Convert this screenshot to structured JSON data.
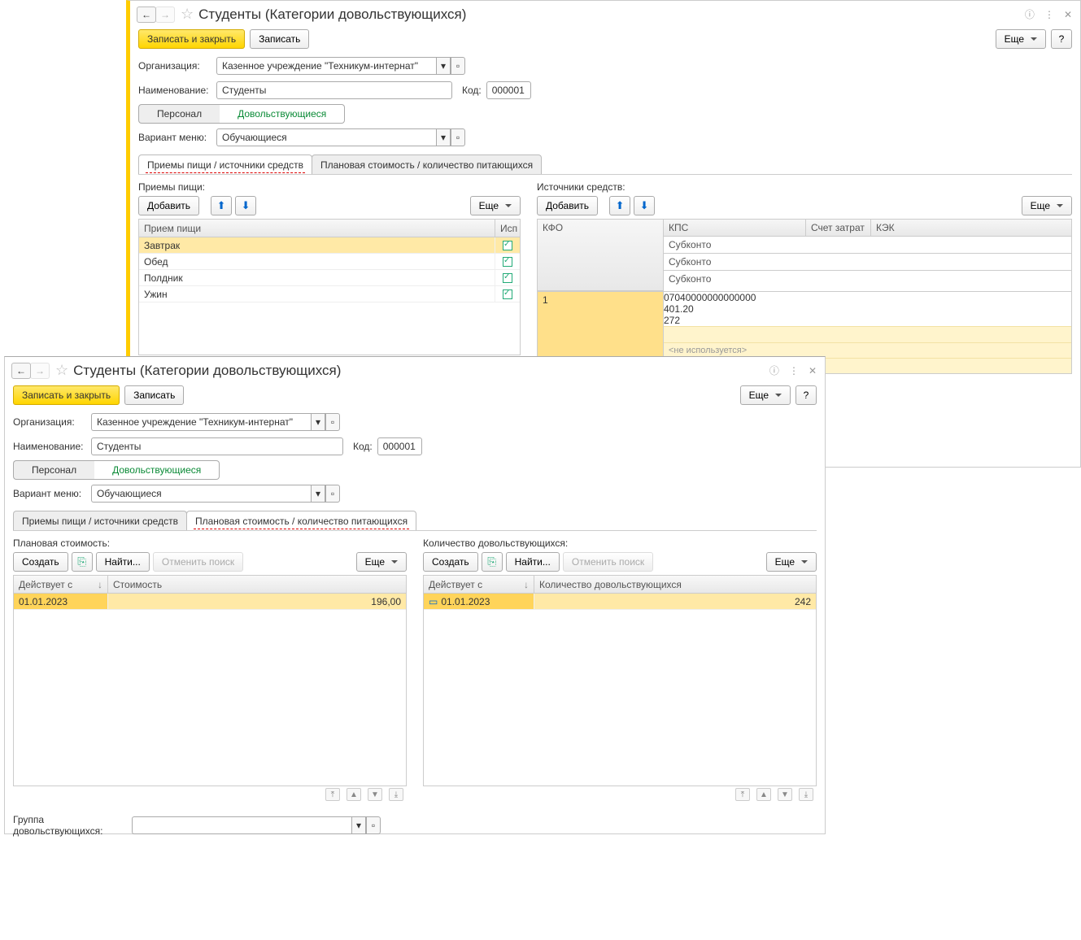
{
  "win": {
    "title": "Студенты (Категории довольствующихся)",
    "save_close": "Записать и закрыть",
    "save": "Записать",
    "more": "Еще",
    "help": "?",
    "org_label": "Организация:",
    "org_value": "Казенное учреждение \"Техникум-интернат\"",
    "name_label": "Наименование:",
    "name_value": "Студенты",
    "code_label": "Код:",
    "code_value": "000001",
    "tab_personal": "Персонал",
    "tab_catered": "Довольствующиеся",
    "menu_variant_label": "Вариант меню:",
    "menu_variant_value": "Обучающиеся"
  },
  "w1": {
    "page_tab1": "Приемы пищи / источники средств",
    "page_tab2": "Плановая стоимость / количество питающихся",
    "meals": {
      "title": "Приемы пищи:",
      "add": "Добавить",
      "more": "Еще",
      "col_meal": "Прием пищи",
      "col_use": "Исп",
      "rows": [
        "Завтрак",
        "Обед",
        "Полдник",
        "Ужин"
      ]
    },
    "funds": {
      "title": "Источники средств:",
      "add": "Добавить",
      "more": "Еще",
      "h_kfo": "КФО",
      "h_kps": "КПС",
      "h_cost": "Счет затрат",
      "h_kek": "КЭК",
      "sub": "Субконто",
      "row_kfo": "1",
      "row_kps": "07040000000000000",
      "row_cost": "401.20",
      "row_kek": "272",
      "not_used": "<не используется>"
    }
  },
  "w2": {
    "page_tab1": "Приемы пищи / источники средств",
    "page_tab2": "Плановая стоимость / количество питающихся",
    "plan_cost": {
      "title": "Плановая стоимость:",
      "create": "Создать",
      "find": "Найти...",
      "cancel_find": "Отменить поиск",
      "more": "Еще",
      "col_date": "Действует с",
      "col_cost": "Стоимость",
      "row_date": "01.01.2023",
      "row_cost": "196,00"
    },
    "qty": {
      "title": "Количество довольствующихся:",
      "create": "Создать",
      "find": "Найти...",
      "cancel_find": "Отменить поиск",
      "more": "Еще",
      "col_date": "Действует с",
      "col_qty": "Количество довольствующихся",
      "row_date": "01.01.2023",
      "row_qty": "242"
    },
    "group_label": "Группа довольствующихся:"
  }
}
